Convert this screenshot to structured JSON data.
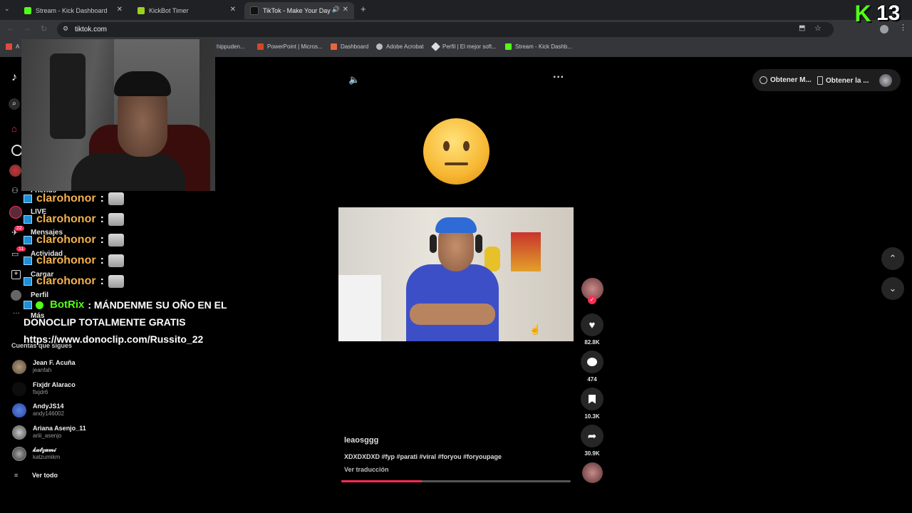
{
  "browser": {
    "tabs": [
      {
        "title": "Stream - Kick Dashboard",
        "favicon_color": "#53fc18"
      },
      {
        "title": "KickBot Timer",
        "favicon_color": "#9bd11c"
      },
      {
        "title": "TikTok - Make Your Day",
        "favicon_color": "#111111"
      }
    ],
    "url": "tiktok.com",
    "bookmarks": [
      {
        "label": "A",
        "icon_color": "#e04a3b"
      },
      {
        "label": "hippuden...",
        "icon_color": "#888888"
      },
      {
        "label": "PowerPoint | Micros...",
        "icon_color": "#d24726"
      },
      {
        "label": "Dashboard",
        "icon_color": "#e8663a"
      },
      {
        "label": "Adobe Acrobat",
        "icon_color": "#bbbbbb"
      },
      {
        "label": "Perfil | El mejor soft...",
        "icon_color": "#dddddd"
      },
      {
        "label": "Stream - Kick Dashb...",
        "icon_color": "#53fc18"
      }
    ]
  },
  "overlay": {
    "kick_logo": "K",
    "kick_count": "13",
    "kick_color": "#53fc18"
  },
  "sidebar": {
    "nav": [
      {
        "label": "Friends",
        "icon": "friends-icon"
      },
      {
        "label": "LIVE",
        "icon": "live-icon"
      },
      {
        "label": "Mensajes",
        "icon": "messages-icon",
        "badge": "22"
      },
      {
        "label": "Actividad",
        "icon": "activity-icon",
        "badge": "11"
      },
      {
        "label": "Cargar",
        "icon": "upload-icon"
      },
      {
        "label": "Perfil",
        "icon": "profile-icon"
      },
      {
        "label": "Más",
        "icon": "more-icon"
      }
    ],
    "following_title": "Cuentas que sigues",
    "following": [
      {
        "name": "Jean F. Acuña",
        "handle": "jeanfah",
        "color": "#8a7a6a"
      },
      {
        "name": "Fixjdr Alaraco",
        "handle": "fixjdr6",
        "color": "#111111"
      },
      {
        "name": "AndyJS14",
        "handle": "andy146002",
        "color": "#3a63c9"
      },
      {
        "name": "Ariana Asenjo_11",
        "handle": "ariii_asenjo",
        "color": "#a0a0a0"
      },
      {
        "name": "𝓀𝒶𝓉𝓏𝓊𝓂𝒾",
        "handle": "katzumikm",
        "color": "#777777"
      }
    ],
    "see_all": "Ver todo"
  },
  "chat": {
    "messages": [
      {
        "user": "clarohonor",
        "sep": ":"
      },
      {
        "user": "clarohonor",
        "sep": ":"
      },
      {
        "user": "clarohonor",
        "sep": ":"
      },
      {
        "user": "clarohonor",
        "sep": ":"
      },
      {
        "user": "clarohonor",
        "sep": ":"
      }
    ],
    "bot_user": "BotRix",
    "bot_line1": ": MÁNDENME SU OÑO EN EL",
    "bot_line2": "DONOCLIP TOTALMENTE GRATIS",
    "bot_line3": "https://www.donoclip.com/Russito_22"
  },
  "header_right": {
    "btn1": "Obtener M...",
    "btn2": "Obtener la ..."
  },
  "video": {
    "emoji": "😐",
    "author": "leaosggg",
    "caption": "XDXDXDXD #fyp #parati #viral #foryou #foryoupage",
    "translate": "Ver traducción",
    "progress": 0.35
  },
  "actions": {
    "likes": "82.8K",
    "comments": "474",
    "saves": "10.3K",
    "shares": "30.9K"
  }
}
